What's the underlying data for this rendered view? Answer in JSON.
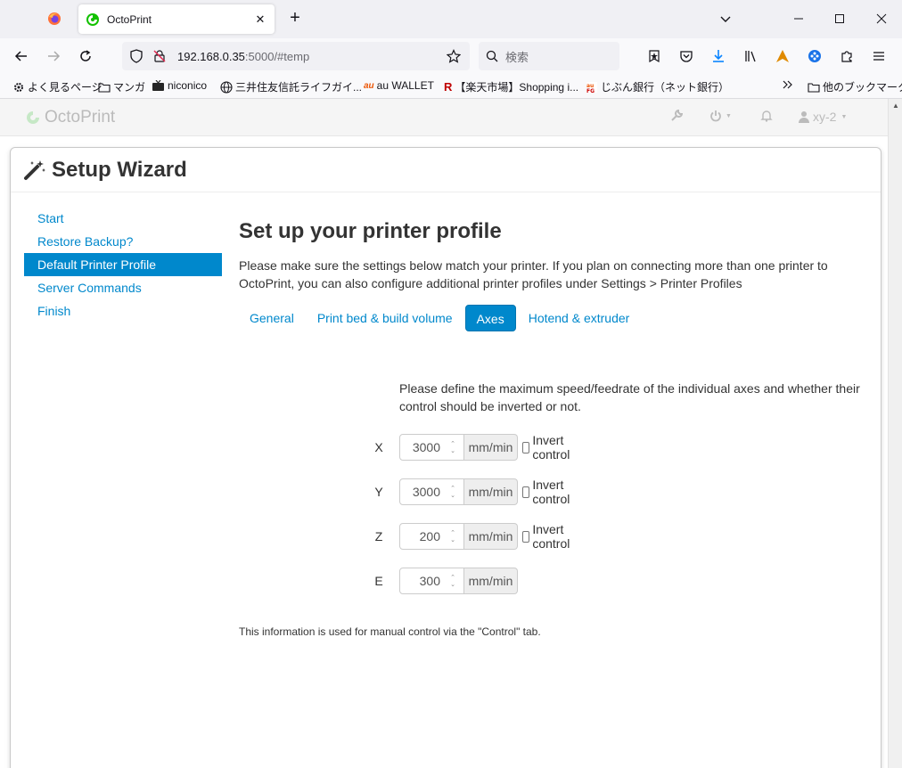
{
  "browser": {
    "tab_title": "OctoPrint",
    "url_host": "192.168.0.35",
    "url_rest": ":5000/#temp",
    "search_placeholder": "検索",
    "bookmarks": [
      {
        "label": "よく見るページ",
        "icon": "gear-icon"
      },
      {
        "label": "マンガ",
        "icon": "folder-icon"
      },
      {
        "label": "niconico",
        "icon": "tv-icon"
      },
      {
        "label": "三井住友信託ライフガイ...",
        "icon": "globe-icon"
      },
      {
        "label": "au WALLET",
        "icon": "au-icon"
      },
      {
        "label": "【楽天市場】Shopping i...",
        "icon": "rakuten-icon"
      },
      {
        "label": "じぶん銀行（ネット銀行）",
        "icon": "bank-icon"
      }
    ],
    "bookmarks_other": "他のブックマーク"
  },
  "octoprint": {
    "brand": "OctoPrint",
    "user": "xy-2",
    "brand_color": "#5fb85f",
    "link_color": "#0088cc"
  },
  "wizard": {
    "title": "Setup Wizard",
    "nav": [
      {
        "label": "Start",
        "active": false
      },
      {
        "label": "Restore Backup?",
        "active": false
      },
      {
        "label": "Default Printer Profile",
        "active": true
      },
      {
        "label": "Server Commands",
        "active": false
      },
      {
        "label": "Finish",
        "active": false
      }
    ],
    "heading": "Set up your printer profile",
    "intro": "Please make sure the settings below match your printer. If you plan on connecting more than one printer to OctoPrint, you can also configure additional printer profiles under Settings > Printer Profiles",
    "tabs": [
      {
        "label": "General",
        "active": false
      },
      {
        "label": "Print bed & build volume",
        "active": false
      },
      {
        "label": "Axes",
        "active": true
      },
      {
        "label": "Hotend & extruder",
        "active": false
      }
    ],
    "axes_description": "Please define the maximum speed/feedrate of the individual axes and whether their control should be inverted or not.",
    "axes": [
      {
        "axis": "X",
        "value": "3000",
        "unit": "mm/min",
        "invert_label": "Invert control",
        "has_invert": true
      },
      {
        "axis": "Y",
        "value": "3000",
        "unit": "mm/min",
        "invert_label": "Invert control",
        "has_invert": true
      },
      {
        "axis": "Z",
        "value": "200",
        "unit": "mm/min",
        "invert_label": "Invert control",
        "has_invert": true
      },
      {
        "axis": "E",
        "value": "300",
        "unit": "mm/min",
        "has_invert": false
      }
    ],
    "footnote": "This information is used for manual control via the \"Control\" tab."
  }
}
